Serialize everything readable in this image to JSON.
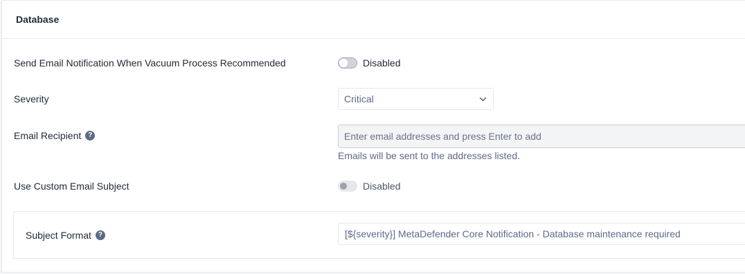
{
  "section": {
    "title": "Database"
  },
  "vacuum_notification": {
    "label": "Send Email Notification When Vacuum Process Recommended",
    "toggle_enabled": false,
    "toggle_text": "Disabled"
  },
  "severity": {
    "label": "Severity",
    "selected": "Critical",
    "chevron_icon": "chevron-down-icon"
  },
  "email_recipient": {
    "label": "Email Recipient",
    "help_icon": "question-circle-icon",
    "help_glyph": "?",
    "value": "",
    "placeholder": "Enter email addresses and press Enter to add",
    "hint": "Emails will be sent to the addresses listed."
  },
  "custom_subject": {
    "label": "Use Custom Email Subject",
    "toggle_enabled": false,
    "toggle_text": "Disabled"
  },
  "subject_format": {
    "label": "Subject Format",
    "help_icon": "question-circle-icon",
    "help_glyph": "?",
    "value": "[${severity}] MetaDefender Core Notification - Database maintenance required"
  },
  "colors": {
    "text": "#1f2937",
    "muted_blue": "#5b6a87",
    "border": "#e5e7eb",
    "input_disabled_bg": "#f3f4f6"
  }
}
